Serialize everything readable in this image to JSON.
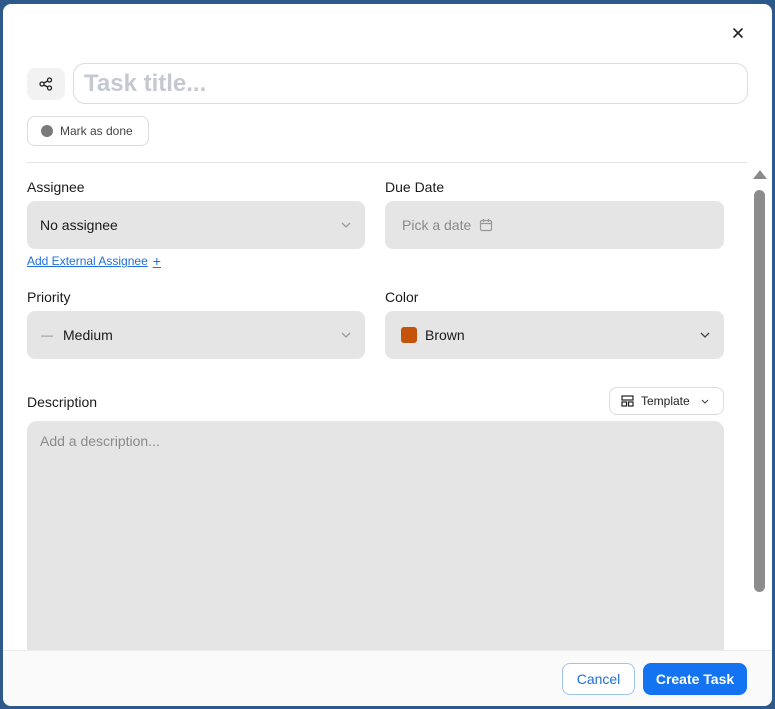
{
  "task": {
    "title_placeholder": "Task title...",
    "mark_done_label": "Mark as done"
  },
  "assignee": {
    "label": "Assignee",
    "value": "No assignee",
    "external_link": "Add External Assignee",
    "external_link_icon": "+"
  },
  "due_date": {
    "label": "Due Date",
    "placeholder": "Pick a date"
  },
  "priority": {
    "label": "Priority",
    "icon": "—",
    "value": "Medium"
  },
  "color": {
    "label": "Color",
    "value": "Brown",
    "swatch": "#c4530c"
  },
  "description": {
    "label": "Description",
    "placeholder": "Add a description...",
    "template_label": "Template"
  },
  "footer": {
    "cancel_label": "Cancel",
    "create_label": "Create Task"
  },
  "theme": {
    "accent": "#1473f0",
    "field_bg": "#e5e5e5"
  }
}
